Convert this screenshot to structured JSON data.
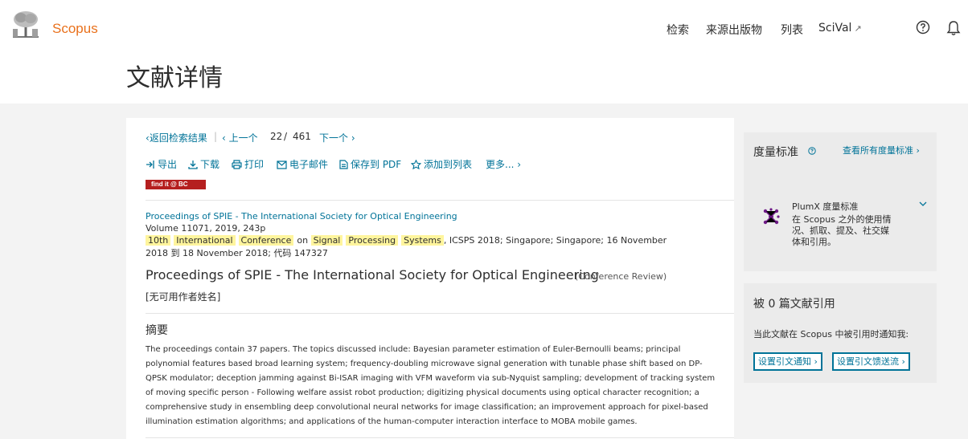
{
  "header": {
    "brand": "Scopus",
    "nav": [
      "检索",
      "来源出版物",
      "列表",
      "SciVal"
    ],
    "page_title": "文献详情"
  },
  "pager": {
    "back": "返回检索结果",
    "prev": "上一个",
    "current": "22",
    "sep": "/",
    "total": "461",
    "next": "下一个"
  },
  "toolbar": {
    "export": "导出",
    "download": "下载",
    "print": "打印",
    "email": "电子邮件",
    "save_pdf": "保存到 PDF",
    "add_list": "添加到列表",
    "more": "更多..."
  },
  "findit": "find it @ BC",
  "document": {
    "source_title": "Proceedings of SPIE - The International Society for Optical Engineering",
    "volume_line": "Volume 11071, 2019, 243p",
    "conference_words_1": [
      "10th",
      "International",
      "Conference"
    ],
    "on_word": "on",
    "conference_words_2": [
      "Signal",
      "Processing",
      "Systems"
    ],
    "conference_rest": ", ICSPS 2018; Singapore; Singapore; 16 November",
    "dates_line": "2018 到 18 November 2018; 代码 147327",
    "title": "Proceedings of SPIE - The International Society for Optical Engineering",
    "doc_type": "(Conference Review)",
    "authors": "[无可用作者姓名]",
    "abstract_heading": "摘要",
    "abstract": "The proceedings contain 37 papers. The topics discussed include: Bayesian parameter estimation of Euler-Bernoulli beams; principal polynomial features based broad learning system; frequency-doubling microwave signal generation with tunable phase shift based on DP-QPSK modulator; deception jamming against Bi-ISAR imaging with VFM waveform via sub-Nyquist sampling; development of tracking system of moving specific person - Following welfare assist robot production; digitizing physical documents using optical character recognition; a comprehensive study in ensembling deep convolutional neural networks for image classification; an improvement approach for pixel-based illumination estimation algorithms; and applications of the human-computer interaction interface to MOBA mobile games."
  },
  "metrics": {
    "title": "度量标准",
    "view_all": "查看所有度量标准",
    "plumx_title": "PlumX 度量标准",
    "plumx_desc": "在 Scopus 之外的使用情况、抓取、提及、社交媒体和引用。"
  },
  "cited": {
    "title": "被 0 篇文献引用",
    "desc": "当此文献在 Scopus 中被引用时通知我:",
    "btn_alert": "设置引文通知",
    "btn_feed": "设置引文馈送流"
  },
  "colors": {
    "brand_orange": "#e9711c",
    "link_blue": "#007398",
    "highlight": "#fff59d",
    "findit_red": "#b51f1f",
    "plumx_purple": "#6e1a87"
  }
}
